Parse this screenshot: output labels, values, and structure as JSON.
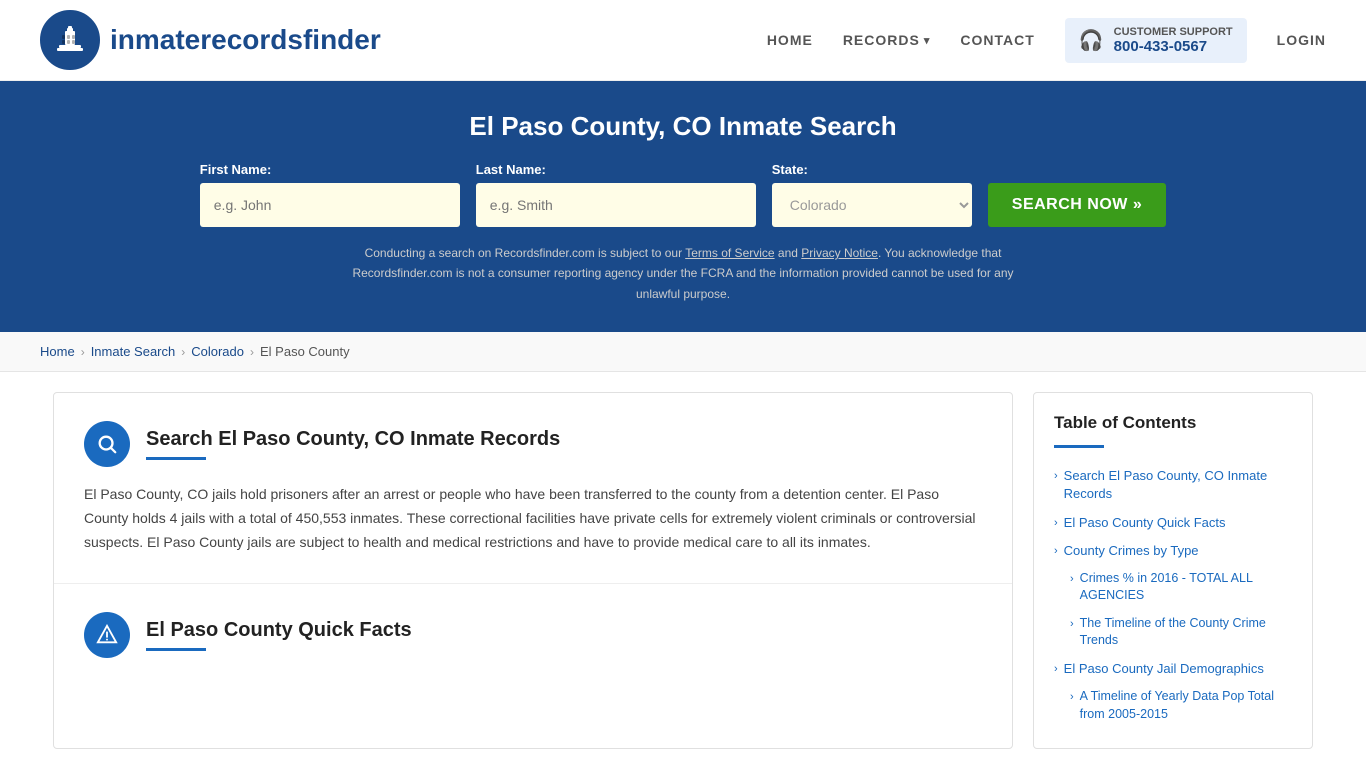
{
  "header": {
    "logo_text_normal": "inmaterecords",
    "logo_text_bold": "finder",
    "nav": {
      "home_label": "HOME",
      "records_label": "RECORDS",
      "contact_label": "CONTACT",
      "support_label": "CUSTOMER SUPPORT",
      "support_number": "800-433-0567",
      "login_label": "LOGIN"
    }
  },
  "hero": {
    "title": "El Paso County, CO Inmate Search",
    "first_name_label": "First Name:",
    "first_name_placeholder": "e.g. John",
    "last_name_label": "Last Name:",
    "last_name_placeholder": "e.g. Smith",
    "state_label": "State:",
    "state_value": "Colorado",
    "search_button": "SEARCH NOW »",
    "disclaimer": "Conducting a search on Recordsfinder.com is subject to our Terms of Service and Privacy Notice. You acknowledge that Recordsfinder.com is not a consumer reporting agency under the FCRA and the information provided cannot be used for any unlawful purpose."
  },
  "breadcrumb": {
    "home": "Home",
    "inmate_search": "Inmate Search",
    "colorado": "Colorado",
    "current": "El Paso County"
  },
  "main": {
    "section1": {
      "title": "Search El Paso County, CO Inmate Records",
      "body": "El Paso County, CO jails hold prisoners after an arrest or people who have been transferred to the county from a detention center. El Paso County holds 4 jails with a total of 450,553 inmates. These correctional facilities have private cells for extremely violent criminals or controversial suspects. El Paso County jails are subject to health and medical restrictions and have to provide medical care to all its inmates."
    },
    "section2": {
      "title": "El Paso County Quick Facts"
    }
  },
  "toc": {
    "title": "Table of Contents",
    "items": [
      {
        "label": "Search El Paso County, CO Inmate Records",
        "sub": false
      },
      {
        "label": "El Paso County Quick Facts",
        "sub": false
      },
      {
        "label": "County Crimes by Type",
        "sub": false
      },
      {
        "label": "Crimes % in 2016 - TOTAL ALL AGENCIES",
        "sub": true
      },
      {
        "label": "The Timeline of the County Crime Trends",
        "sub": true
      },
      {
        "label": "El Paso County Jail Demographics",
        "sub": false
      },
      {
        "label": "A Timeline of Yearly Data Pop Total from 2005-2015",
        "sub": true
      }
    ]
  }
}
